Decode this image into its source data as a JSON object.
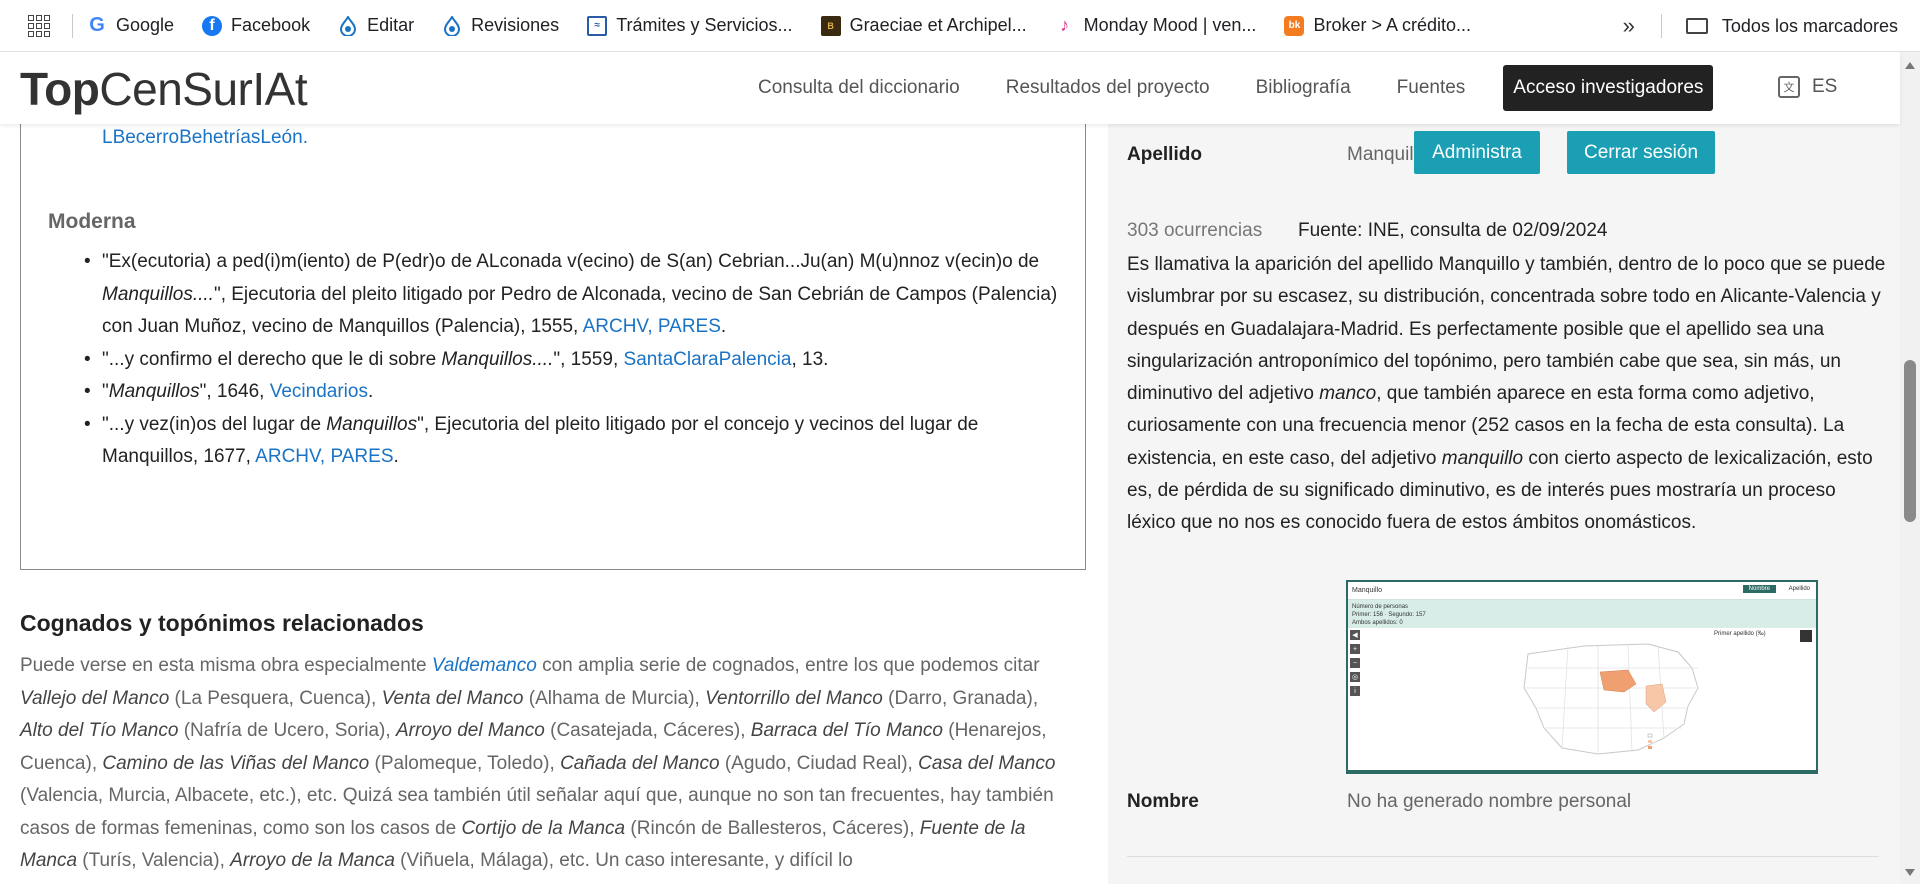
{
  "bookmarks": [
    {
      "label": "Google",
      "icon": "google-icon"
    },
    {
      "label": "Facebook",
      "icon": "facebook-icon"
    },
    {
      "label": "Editar",
      "icon": "drupal-icon"
    },
    {
      "label": "Revisiones",
      "icon": "drupal-icon"
    },
    {
      "label": "Trámites y Servicios...",
      "icon": "tramites-icon"
    },
    {
      "label": "Graeciae et Archipel...",
      "icon": "graeciae-icon"
    },
    {
      "label": "Monday Mood | ven...",
      "icon": "monday-mood-icon"
    },
    {
      "label": "Broker > A crédito...",
      "icon": "broker-icon"
    }
  ],
  "bookmarks_all": "Todos los marcadores",
  "logo": {
    "bold": "Top",
    "rest": "CenSurIAt"
  },
  "nav": {
    "consulta": "Consulta del diccionario",
    "resultados": "Resultados del proyecto",
    "bibliografia": "Bibliografía",
    "fuentes": "Fuentes",
    "acceso": "Acceso investigadores",
    "lang": "ES"
  },
  "left": {
    "top_link": "LBecerroBehetríasLeón.",
    "moderna": "Moderna",
    "q1_a": "\"Ex(ecutoria) a ped(i)m(iento) de P(edr)o de ALconada v(ecino) de S(an) Cebrian...Ju(an) M(u)nnoz v(ecin)o de ",
    "q1_i": "Manquillos....",
    "q1_b": "\", Ejecutoria del pleito litigado por Pedro de Alconada, vecino de San Cebrián de Campos (Palencia) con Juan Muñoz, vecino de Manquillos (Palencia), 1555, ",
    "q1_link": "ARCHV, PARES",
    "q2_a": "\"...y confirmo el derecho que le di sobre ",
    "q2_i": "Manquillos....",
    "q2_b": "\", 1559, ",
    "q2_link": "SantaClaraPalencia",
    "q2_c": ", 13.",
    "q3_a": "\"",
    "q3_i": "Manquillos",
    "q3_b": "\", 1646, ",
    "q3_link": "Vecindarios",
    "q4_a": "\"...y vez(in)os del lugar de ",
    "q4_i": "Manquillos",
    "q4_b": "\", Ejecutoria del pleito litigado por el concejo y vecinos del lugar de Manquillos, 1677, ",
    "q4_link": "ARCHV, PARES",
    "dot": "."
  },
  "cognados": {
    "title": "Cognados y topónimos relacionados",
    "p1": "Puede verse en esta misma obra especialmente ",
    "link": "Valdemanco",
    "p2": " con amplia serie de cognados, entre los que podemos citar ",
    "i1": "Vallejo del Manco",
    "t1": " (La Pesquera, Cuenca), ",
    "i2": "Venta del Manco",
    "t2": " (Alhama de Murcia), ",
    "i3": "Ventorrillo del Manco",
    "t3": " (Darro, Granada), ",
    "i4": "Alto del Tío Manco",
    "t4": " (Nafría de Ucero, Soria), ",
    "i5": "Arroyo del Manco",
    "t5": " (Casatejada, Cáceres), ",
    "i6": "Barraca del Tío Manco",
    "t6": " (Henarejos, Cuenca), ",
    "i7": "Camino de las Viñas del Manco",
    "t7": " (Palomeque, Toledo), ",
    "i8": "Cañada del Manco",
    "t8": " (Agudo, Ciudad Real), ",
    "i9": "Casa del Manco",
    "t9": " (Valencia, Murcia, Albacete, etc.), etc. Quizá sea también útil señalar aquí que, aunque no son tan frecuentes, hay también casos de formas femeninas, como son los casos de ",
    "i10": "Cortijo de la Manca",
    "t10": " (Rincón de Ballesteros, Cáceres), ",
    "i11": "Fuente de la Manca",
    "t11": " (Turís, Valencia), ",
    "i12": "Arroyo de la Manca",
    "t12": " (Viñuela, Málaga), etc. Un caso interesante, y difícil lo"
  },
  "right": {
    "apellido_label": "Apellido",
    "apellido_value": "Manquillo",
    "admin_button": "Administra",
    "logout_button": "Cerrar sesión",
    "occurrences": "303 ocurrencias",
    "source": "Fuente: INE, consulta de 02/09/2024",
    "d1": "Es llamativa la aparición del apellido Manquillo y también, dentro de lo poco que se puede vislumbrar por su escasez, su distribución, concentrada sobre todo en Alicante-Valencia y después en Guadalajara-Madrid. Es perfectamente posible que el apellido sea una singularización antroponímico del topónimo, pero también cabe que sea, sin más, un diminutivo del adjetivo ",
    "d1_i": "manco",
    "d2": ", que también aparece en esta forma como adjetivo, curiosamente con una frecuencia menor (252 casos en la fecha de esta consulta). La existencia, en este caso, del adjetivo ",
    "d2_i": "manquillo",
    "d3": " con cierto aspecto de lexicalización, esto es, de pérdida de su significado diminutivo, es de interés pues mostraría un proceso léxico que no nos es conocido fuera de estos ámbitos onomásticos.",
    "nombre_label": "Nombre",
    "nombre_value": "No ha generado nombre personal"
  },
  "map": {
    "search_value": "Manquillo",
    "btn_nombre": "Nombre",
    "btn_apellido": "Apellido",
    "stats1": "Número de personas",
    "stats2": "Primer: 156 · Segundo: 157",
    "stats3": "Ambos apellidos: 0",
    "legend_title": "Primer apellido (‰)",
    "colors": {
      "frame": "#2c6b64",
      "high": "#f0a070",
      "mid": "#f7c7a8",
      "low": "#ffffff"
    }
  }
}
